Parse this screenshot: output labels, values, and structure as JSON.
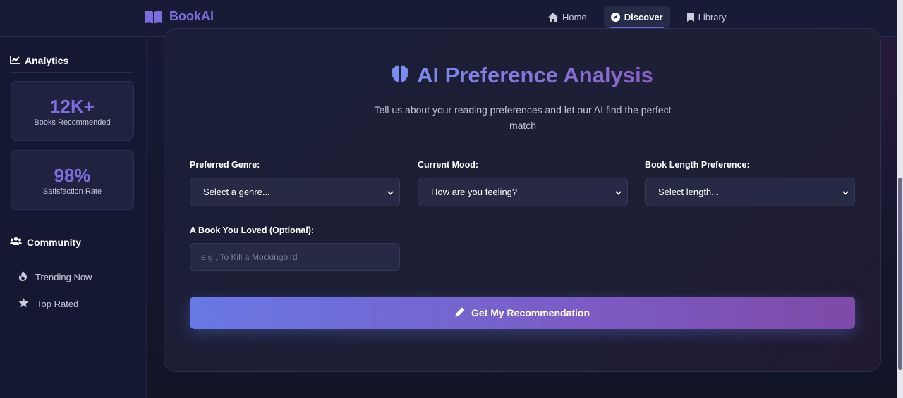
{
  "brand": {
    "name": "BookAI",
    "icon": "open-book-icon",
    "color": "#7b6fe0"
  },
  "nav": {
    "items": [
      {
        "label": "Home",
        "icon": "home-icon",
        "active": false
      },
      {
        "label": "Discover",
        "icon": "compass-icon",
        "active": true
      },
      {
        "label": "Library",
        "icon": "bookmark-icon",
        "active": false
      }
    ]
  },
  "sidebar": {
    "analytics": {
      "heading": "Analytics",
      "icon": "line-chart-icon",
      "stats": [
        {
          "value": "12K+",
          "label": "Books Recommended"
        },
        {
          "value": "98%",
          "label": "Satisfaction Rate"
        }
      ]
    },
    "community": {
      "heading": "Community",
      "icon": "users-icon",
      "items": [
        {
          "label": "Trending Now",
          "icon": "flame-icon"
        },
        {
          "label": "Top Rated",
          "icon": "star-icon"
        }
      ]
    }
  },
  "main": {
    "title": "AI Preference Analysis",
    "title_icon": "brain-icon",
    "subtitle": "Tell us about your reading preferences and let our AI find the perfect match",
    "fields": {
      "genre": {
        "label": "Preferred Genre:",
        "value": "Select a genre..."
      },
      "mood": {
        "label": "Current Mood:",
        "value": "How are you feeling?"
      },
      "length": {
        "label": "Book Length Preference:",
        "value": "Select length..."
      },
      "loved": {
        "label": "A Book You Loved (Optional):",
        "value": "",
        "placeholder": "e.g., To Kill a Mockingbird"
      }
    },
    "cta": {
      "label": "Get My Recommendation",
      "icon": "pencil-icon"
    }
  },
  "colors": {
    "accent": "#7b6fe0",
    "cta_start": "#6878e4",
    "cta_end": "#7d4aa8",
    "background": "#14162b"
  }
}
